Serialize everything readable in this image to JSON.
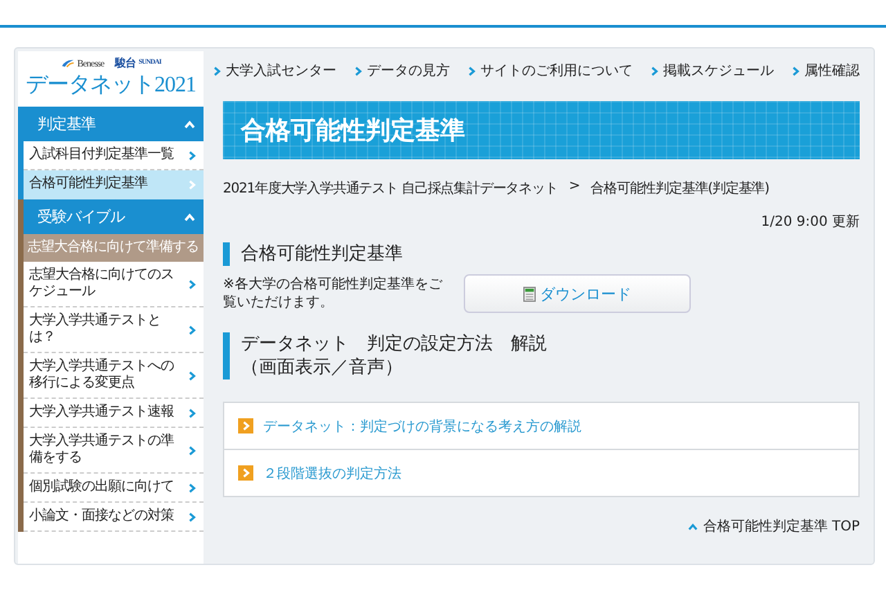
{
  "logo": {
    "brand_1": "Benesse",
    "brand_2": "駿台",
    "brand_2_sub": "SUNDAI",
    "title": "データネット2021"
  },
  "sidebar": {
    "sections": [
      {
        "title": "判定基準",
        "expanded": true,
        "color": "#1a8fd0",
        "items": [
          {
            "kind": "link",
            "label": "入試科目付判定基準一覧",
            "selected": false
          },
          {
            "kind": "link",
            "label": "合格可能性判定基準",
            "selected": true
          }
        ]
      },
      {
        "title": "受験バイブル",
        "expanded": true,
        "color": "#8a6a4a",
        "items": [
          {
            "kind": "subheader",
            "label": "志望大合格に向けて準備する"
          },
          {
            "kind": "link",
            "label": "志望大合格に向けてのスケジュール",
            "selected": false
          },
          {
            "kind": "link",
            "label": "大学入学共通テストとは？",
            "selected": false
          },
          {
            "kind": "link",
            "label": "大学入学共通テストへの移行による変更点",
            "selected": false
          },
          {
            "kind": "link",
            "label": "大学入学共通テスト速報",
            "selected": false
          },
          {
            "kind": "link",
            "label": "大学入学共通テストの準備をする",
            "selected": false
          },
          {
            "kind": "link",
            "label": "個別試験の出願に向けて",
            "selected": false
          },
          {
            "kind": "link",
            "label": "小論文・面接などの対策",
            "selected": false
          }
        ]
      }
    ]
  },
  "top_nav": [
    "大学入試センター",
    "データの見方",
    "サイトのご利用について",
    "掲載スケジュール",
    "属性確認"
  ],
  "banner_title": "合格可能性判定基準",
  "breadcrumb": [
    "2021年度大学入学共通テスト 自己採点集計データネット",
    "合格可能性判定基準(判定基準)"
  ],
  "breadcrumb_separator": ">",
  "updated": "1/20 9:00 更新",
  "section_1": {
    "heading": "合格可能性判定基準",
    "note": "※各大学の合格可能性判定基準をご覧いただけます。",
    "button": "ダウンロード"
  },
  "section_2": {
    "heading_lines": [
      "データネット　判定の設定方法　解説",
      "（画面表示／音声）"
    ],
    "links": [
      "データネット：判定づけの背景になる考え方の解説",
      "２段階選抜の判定方法"
    ]
  },
  "back_to_top": "合格可能性判定基準 TOP"
}
